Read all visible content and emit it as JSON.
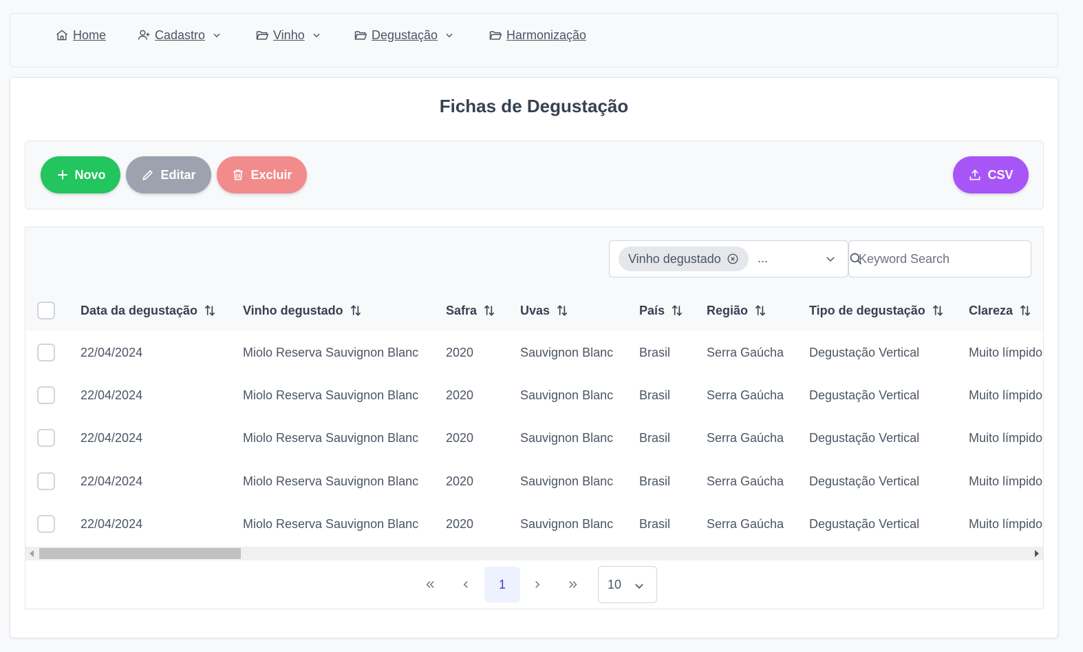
{
  "menu": {
    "home": "Home",
    "cadastro": "Cadastro",
    "vinho": "Vinho",
    "degustacao": "Degustação",
    "harmonizacao": "Harmonização"
  },
  "page": {
    "title": "Fichas de Degustação"
  },
  "toolbar": {
    "novo_label": "Novo",
    "editar_label": "Editar",
    "excluir_label": "Excluir",
    "csv_label": "CSV"
  },
  "filter": {
    "chip_label": "Vinho degustado",
    "more": "...",
    "search_placeholder": "Keyword Search"
  },
  "table": {
    "columns": [
      "Data da degustação",
      "Vinho degustado",
      "Safra",
      "Uvas",
      "País",
      "Região",
      "Tipo de degustação",
      "Clareza"
    ],
    "rows": [
      [
        "22/04/2024",
        "Miolo Reserva Sauvignon Blanc",
        "2020",
        "Sauvignon Blanc",
        "Brasil",
        "Serra Gaúcha",
        "Degustação Vertical",
        "Muito límpido"
      ],
      [
        "22/04/2024",
        "Miolo Reserva Sauvignon Blanc",
        "2020",
        "Sauvignon Blanc",
        "Brasil",
        "Serra Gaúcha",
        "Degustação Vertical",
        "Muito límpido"
      ],
      [
        "22/04/2024",
        "Miolo Reserva Sauvignon Blanc",
        "2020",
        "Sauvignon Blanc",
        "Brasil",
        "Serra Gaúcha",
        "Degustação Vertical",
        "Muito límpido"
      ],
      [
        "22/04/2024",
        "Miolo Reserva Sauvignon Blanc",
        "2020",
        "Sauvignon Blanc",
        "Brasil",
        "Serra Gaúcha",
        "Degustação Vertical",
        "Muito límpido"
      ],
      [
        "22/04/2024",
        "Miolo Reserva Sauvignon Blanc",
        "2020",
        "Sauvignon Blanc",
        "Brasil",
        "Serra Gaúcha",
        "Degustação Vertical",
        "Muito límpido"
      ]
    ]
  },
  "pagination": {
    "current_page": "1",
    "rows_per_page": "10"
  },
  "colors": {
    "novo": "#22c55e",
    "editar": "#9ca3af",
    "excluir": "#f28b8b",
    "csv": "#a855f7",
    "active_page": "#eef2ff"
  },
  "icons": {
    "home": "home-icon",
    "cadastro": "user-plus-icon",
    "folder": "folder-open-icon",
    "sort": "sort-icon",
    "search": "search-icon"
  }
}
